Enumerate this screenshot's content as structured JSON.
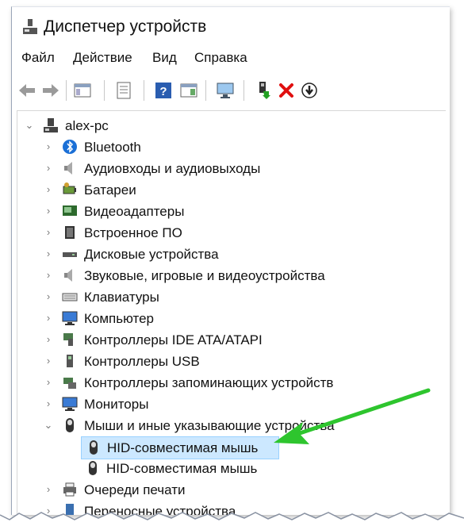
{
  "window": {
    "title": "Диспетчер устройств"
  },
  "menu": [
    "Файл",
    "Действие",
    "Вид",
    "Справка"
  ],
  "tree": {
    "root": "alex-pc",
    "categories": [
      {
        "label": "Bluetooth",
        "icon": "bluetooth-icon"
      },
      {
        "label": "Аудиовходы и аудиовыходы",
        "icon": "speaker-icon"
      },
      {
        "label": "Батареи",
        "icon": "battery-icon"
      },
      {
        "label": "Видеоадаптеры",
        "icon": "display-adapter-icon"
      },
      {
        "label": "Встроенное ПО",
        "icon": "firmware-icon"
      },
      {
        "label": "Дисковые устройства",
        "icon": "disk-drive-icon"
      },
      {
        "label": "Звуковые, игровые и видеоустройства",
        "icon": "sound-device-icon"
      },
      {
        "label": "Клавиатуры",
        "icon": "keyboard-icon"
      },
      {
        "label": "Компьютер",
        "icon": "computer-icon"
      },
      {
        "label": "Контроллеры IDE ATA/ATAPI",
        "icon": "ide-controller-icon"
      },
      {
        "label": "Контроллеры USB",
        "icon": "usb-controller-icon"
      },
      {
        "label": "Контроллеры запоминающих устройств",
        "icon": "storage-controller-icon"
      },
      {
        "label": "Мониторы",
        "icon": "monitor-icon"
      },
      {
        "label": "Мыши и иные указывающие устройства",
        "icon": "mouse-icon"
      }
    ],
    "mice": [
      "HID-совместимая мышь",
      "HID-совместимая мышь"
    ],
    "after": [
      {
        "label": "Очереди печати",
        "icon": "printer-icon"
      },
      {
        "label": "Переносные устройства",
        "icon": "portable-device-icon"
      }
    ]
  },
  "colors": {
    "accent_arrow": "#2ec52e",
    "selection": "#cce8ff",
    "delete_red": "#e01010"
  }
}
